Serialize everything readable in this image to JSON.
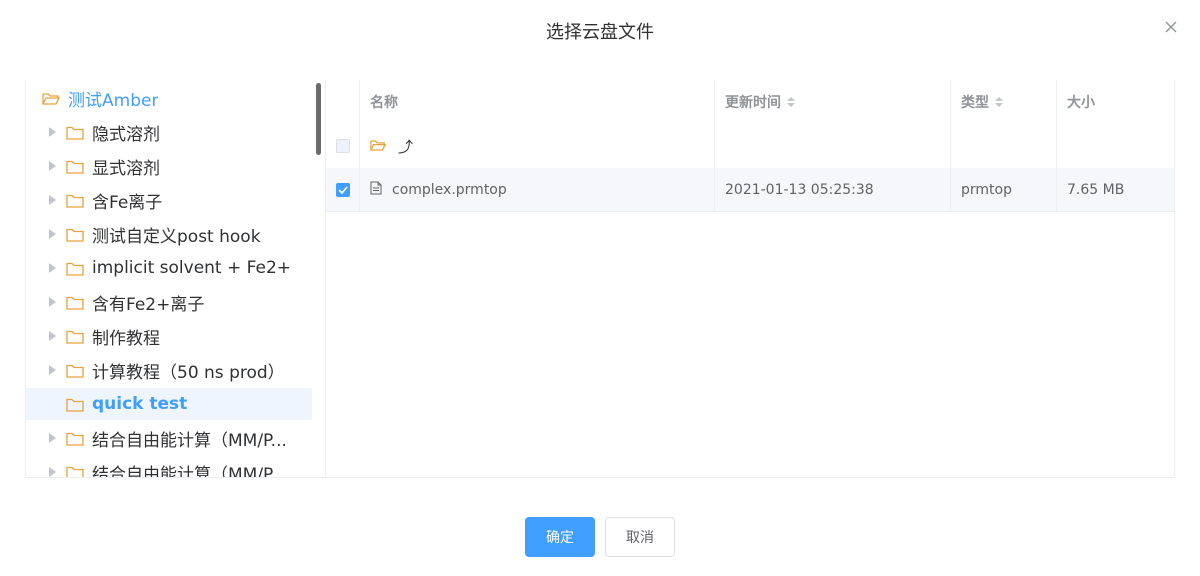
{
  "dialog": {
    "title": "选择云盘文件",
    "confirm_label": "确定",
    "cancel_label": "取消"
  },
  "tree": {
    "root": "测试Amber",
    "items": [
      {
        "label": "隐式溶剂"
      },
      {
        "label": "显式溶剂"
      },
      {
        "label": "含Fe离子"
      },
      {
        "label": "测试自定义post hook"
      },
      {
        "label": "implicit solvent + Fe2+"
      },
      {
        "label": "含有Fe2+离子"
      },
      {
        "label": "制作教程"
      },
      {
        "label": "计算教程（50 ns prod）"
      },
      {
        "label": "quick test",
        "selected": true
      },
      {
        "label": "结合自由能计算（MM/P..."
      },
      {
        "label": "结合自由能计算（MM/P"
      }
    ]
  },
  "table": {
    "headers": {
      "name": "名称",
      "updated": "更新时间",
      "type": "类型",
      "size": "大小"
    },
    "up_symbol": "⤴",
    "rows": [
      {
        "name": "complex.prmtop",
        "updated": "2021-01-13 05:25:38",
        "type": "prmtop",
        "size": "7.65 MB",
        "checked": true
      }
    ]
  },
  "colors": {
    "accent": "#409eff",
    "folder": "#e6a23c",
    "selected_bg": "#eef5fe"
  }
}
